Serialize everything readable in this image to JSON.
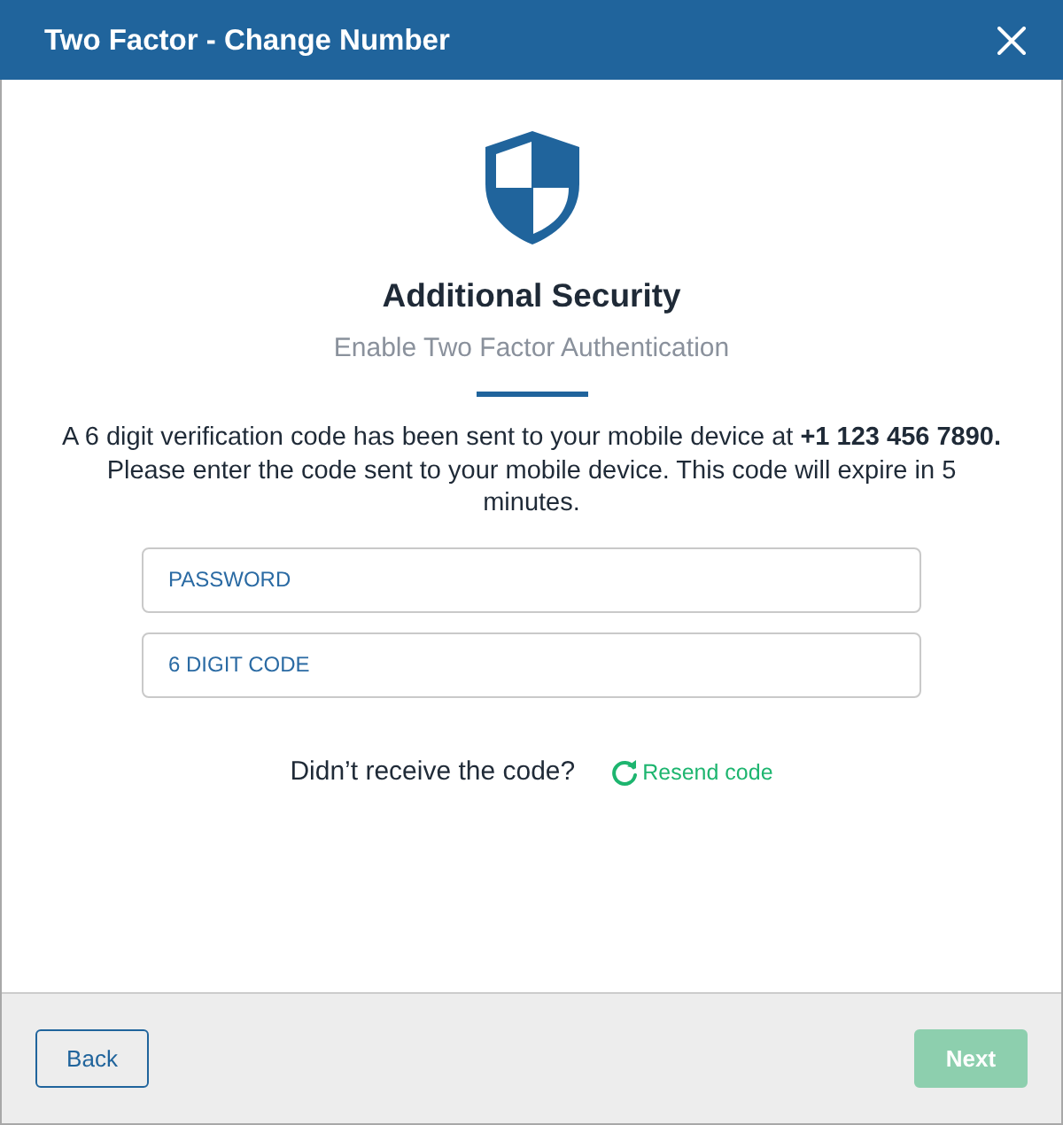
{
  "dialog": {
    "title": "Two Factor - Change Number"
  },
  "content": {
    "heading": "Additional Security",
    "subheading": "Enable Two Factor Authentication",
    "message": "A 6 digit verification code has been sent to your mobile device at **+1 123 456 7890.** Please enter the code sent to your mobile device. This code will expire in 5 minutes."
  },
  "fields": [
    {
      "placeholder": "PASSWORD"
    },
    {
      "placeholder": "6 DIGIT CODE"
    }
  ],
  "resend": {
    "prompt": "Didn’t receive the code?",
    "link": "Resend code"
  },
  "footer": {
    "buttons": [
      {
        "label": "Back",
        "kind": "secondary",
        "disabled": false
      },
      {
        "label": "Next",
        "kind": "primary",
        "disabled": true
      }
    ]
  }
}
